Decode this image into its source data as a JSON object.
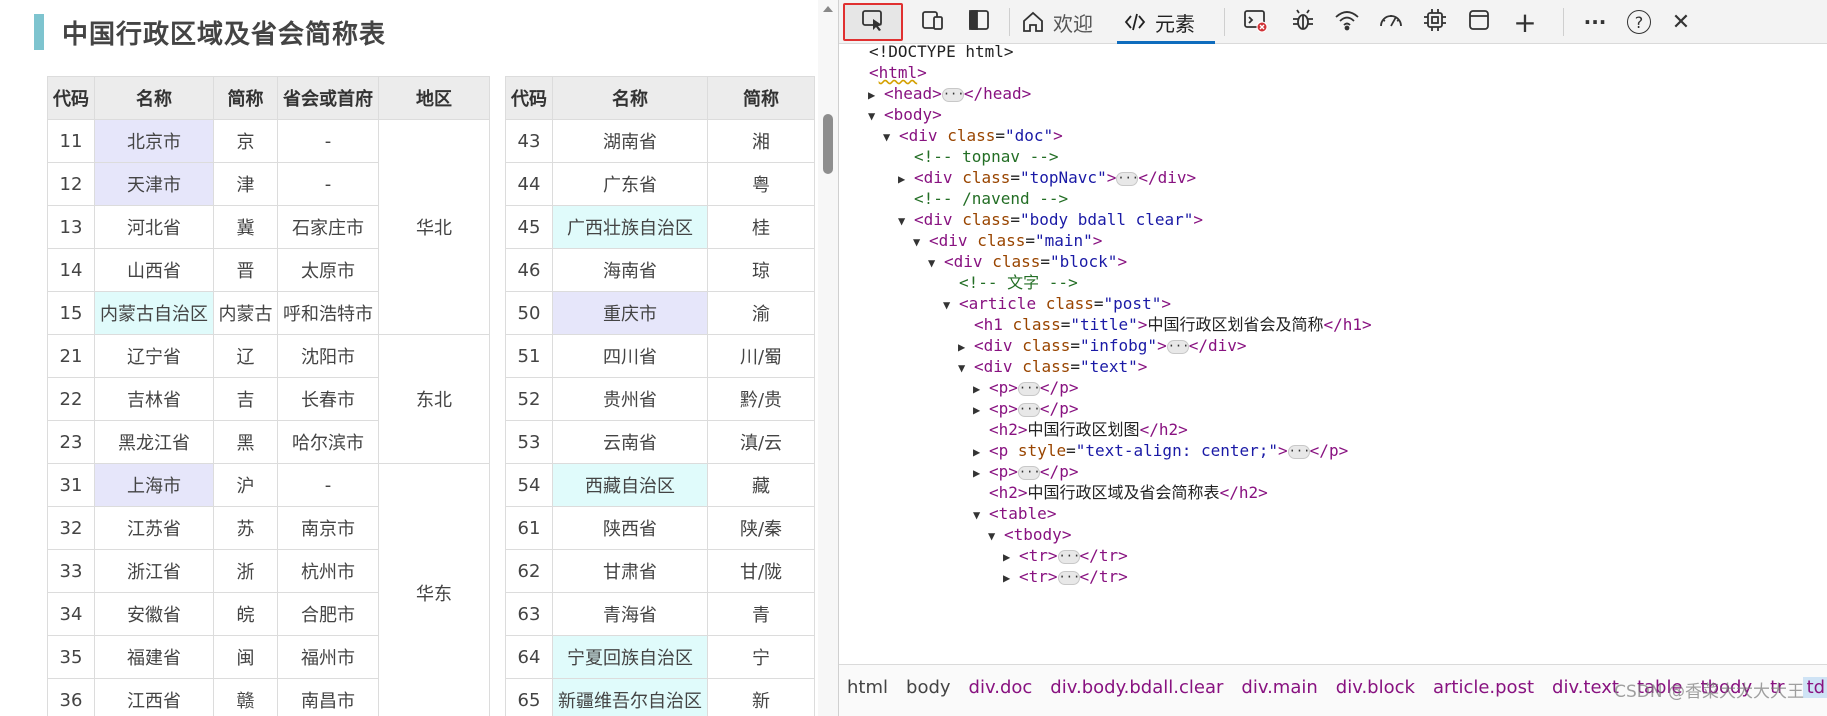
{
  "page": {
    "heading": "中国行政区域及省会简称表",
    "table_left": {
      "headers": [
        "代码",
        "名称",
        "简称",
        "省会或首府",
        "地区"
      ],
      "rows": [
        {
          "code": "11",
          "name": "北京市",
          "abbr": "京",
          "capital": "-",
          "hl": "blue"
        },
        {
          "code": "12",
          "name": "天津市",
          "abbr": "津",
          "capital": "-",
          "hl": "blue"
        },
        {
          "code": "13",
          "name": "河北省",
          "abbr": "冀",
          "capital": "石家庄市",
          "hl": ""
        },
        {
          "code": "14",
          "name": "山西省",
          "abbr": "晋",
          "capital": "太原市",
          "hl": ""
        },
        {
          "code": "15",
          "name": "内蒙古自治区",
          "abbr": "内蒙古",
          "capital": "呼和浩特市",
          "hl": "cyan"
        },
        {
          "code": "21",
          "name": "辽宁省",
          "abbr": "辽",
          "capital": "沈阳市",
          "hl": ""
        },
        {
          "code": "22",
          "name": "吉林省",
          "abbr": "吉",
          "capital": "长春市",
          "hl": ""
        },
        {
          "code": "23",
          "name": "黑龙江省",
          "abbr": "黑",
          "capital": "哈尔滨市",
          "hl": ""
        },
        {
          "code": "31",
          "name": "上海市",
          "abbr": "沪",
          "capital": "-",
          "hl": "blue"
        },
        {
          "code": "32",
          "name": "江苏省",
          "abbr": "苏",
          "capital": "南京市",
          "hl": ""
        },
        {
          "code": "33",
          "name": "浙江省",
          "abbr": "浙",
          "capital": "杭州市",
          "hl": ""
        },
        {
          "code": "34",
          "name": "安徽省",
          "abbr": "皖",
          "capital": "合肥市",
          "hl": ""
        },
        {
          "code": "35",
          "name": "福建省",
          "abbr": "闽",
          "capital": "福州市",
          "hl": ""
        },
        {
          "code": "36",
          "name": "江西省",
          "abbr": "赣",
          "capital": "南昌市",
          "hl": ""
        }
      ],
      "regions": [
        "华北",
        "东北",
        "华东"
      ]
    },
    "table_right": {
      "headers": [
        "代码",
        "名称",
        "简称"
      ],
      "rows": [
        {
          "code": "43",
          "name": "湖南省",
          "abbr": "湘",
          "hl": ""
        },
        {
          "code": "44",
          "name": "广东省",
          "abbr": "粤",
          "hl": ""
        },
        {
          "code": "45",
          "name": "广西壮族自治区",
          "abbr": "桂",
          "hl": "cyan"
        },
        {
          "code": "46",
          "name": "海南省",
          "abbr": "琼",
          "hl": ""
        },
        {
          "code": "50",
          "name": "重庆市",
          "abbr": "渝",
          "hl": "blue"
        },
        {
          "code": "51",
          "name": "四川省",
          "abbr": "川/蜀",
          "hl": ""
        },
        {
          "code": "52",
          "name": "贵州省",
          "abbr": "黔/贵",
          "hl": ""
        },
        {
          "code": "53",
          "name": "云南省",
          "abbr": "滇/云",
          "hl": ""
        },
        {
          "code": "54",
          "name": "西藏自治区",
          "abbr": "藏",
          "hl": "cyan"
        },
        {
          "code": "61",
          "name": "陕西省",
          "abbr": "陕/秦",
          "hl": ""
        },
        {
          "code": "62",
          "name": "甘肃省",
          "abbr": "甘/陇",
          "hl": ""
        },
        {
          "code": "63",
          "name": "青海省",
          "abbr": "青",
          "hl": ""
        },
        {
          "code": "64",
          "name": "宁夏回族自治区",
          "abbr": "宁",
          "hl": "cyan"
        },
        {
          "code": "65",
          "name": "新疆维吾尔自治区",
          "abbr": "新",
          "hl": "cyan"
        }
      ]
    }
  },
  "devtools": {
    "toolbar": {
      "tab_welcome": "欢迎",
      "tab_elements": "元素",
      "icons": [
        "inspect-icon",
        "device-emulation-icon",
        "dock-icon",
        "home-icon",
        "code-icon",
        "console-error-icon",
        "bug-icon",
        "wifi-icon",
        "performance-icon",
        "memory-chip-icon",
        "application-icon",
        "add-tab-icon",
        "more-icon",
        "help-icon",
        "close-icon"
      ],
      "plus": "+",
      "more": "···",
      "help": "?",
      "close": "✕"
    },
    "dom": {
      "doctype": "<!DOCTYPE html>",
      "html": "html",
      "head": "head",
      "body": "body",
      "div": "div",
      "article": "article",
      "h1": "h1",
      "h2": "h2",
      "p": "p",
      "table": "table",
      "tbody": "tbody",
      "tr": "tr",
      "attr_class": "class",
      "attr_style": "style",
      "val_doc": "\"doc\"",
      "val_topnavc": "\"topNavc\"",
      "val_body": "\"body bdall clear\"",
      "val_main": "\"main\"",
      "val_block": "\"block\"",
      "val_post": "\"post\"",
      "val_title": "\"title\"",
      "val_infobg": "\"infobg\"",
      "val_text": "\"text\"",
      "val_center": "\"text-align: center;\"",
      "comment_topnav": "<!-- topnav -->",
      "comment_navend": "<!-- /navend -->",
      "comment_text": "<!-- 文字 -->",
      "h1_text": "中国行政区划省会及简称",
      "h2_text_1": "中国行政区划图",
      "h2_text_2": "中国行政区域及省会简称表",
      "ellipsis": "···"
    },
    "breadcrumbs": [
      "html",
      "body",
      "div.doc",
      "div.body.bdall.clear",
      "div.main",
      "div.block",
      "article.post",
      "div.text",
      "table",
      "tbody",
      "tr",
      "td"
    ],
    "watermark": "CSDN @香菜大大大大王"
  },
  "colors": {
    "heading_bar": "#7ec4cf",
    "highlight_blue": "#e6e6fa",
    "highlight_cyan": "#e0fbfb",
    "tag": "#881280",
    "attr_name": "#994500",
    "attr_value": "#1a1aa6",
    "comment": "#236e25",
    "inspect_border": "#e03030",
    "tab_underline": "#0f6cbd"
  }
}
